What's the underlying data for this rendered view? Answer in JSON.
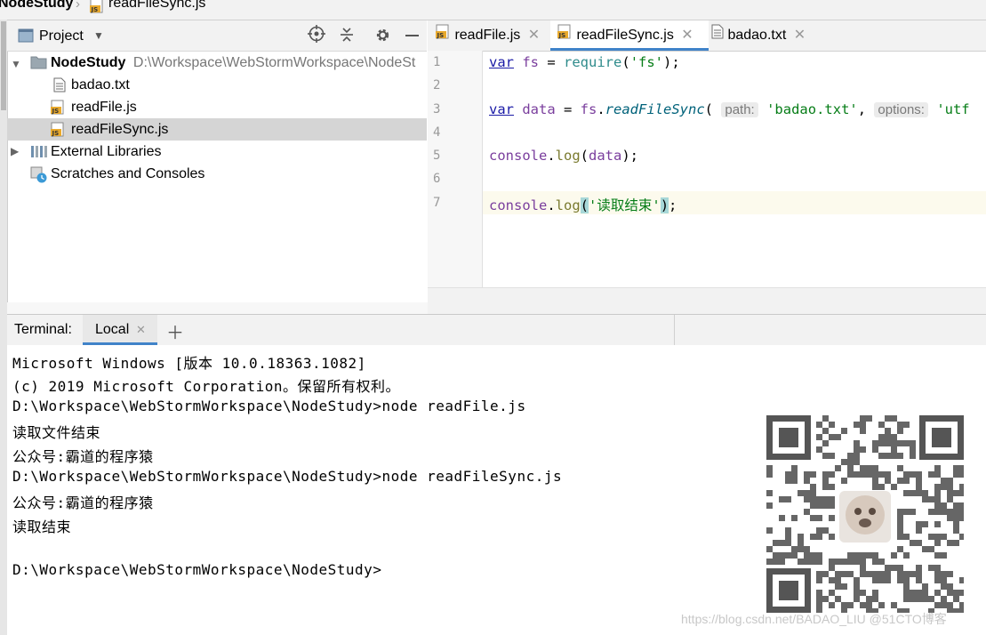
{
  "breadcrumb": {
    "project": "NodeStudy",
    "file": "readFileSync.js"
  },
  "project_panel": {
    "title": "Project",
    "tree": {
      "root_name": "NodeStudy",
      "root_path": "D:\\Workspace\\WebStormWorkspace\\NodeSt",
      "files": [
        "badao.txt",
        "readFile.js",
        "readFileSync.js"
      ],
      "external": "External Libraries",
      "scratches": "Scratches and Consoles"
    }
  },
  "editor": {
    "tabs": [
      "readFile.js",
      "readFileSync.js",
      "badao.txt"
    ],
    "active_tab": "readFileSync.js",
    "line_numbers": [
      "1",
      "2",
      "3",
      "4",
      "5",
      "6",
      "7"
    ],
    "code": {
      "l1": {
        "kw": "var",
        "name": "fs",
        "op": " = ",
        "fn": "require",
        "open": "(",
        "str": "'fs'",
        "close": ");"
      },
      "l3": {
        "kw": "var",
        "name": "data",
        "op": " = ",
        "obj": "fs",
        "dot": ".",
        "fn": "readFileSync",
        "open": "(",
        "hint1": "path:",
        "str1": "'badao.txt'",
        "comma": ",",
        "hint2": "options:",
        "str2": "'utf"
      },
      "l5": {
        "obj": "console",
        "dot": ".",
        "fn": "log",
        "open": "(",
        "arg": "data",
        "close": ");"
      },
      "l7": {
        "obj": "console",
        "dot": ".",
        "fn": "log",
        "open": "(",
        "str": "'读取结束'",
        "close1": ")",
        "close2": ";"
      }
    }
  },
  "terminal": {
    "label": "Terminal:",
    "tab": "Local",
    "lines": [
      "Microsoft Windows [版本 10.0.18363.1082]",
      "(c) 2019 Microsoft Corporation。保留所有权利。",
      "D:\\Workspace\\WebStormWorkspace\\NodeStudy>node readFile.js",
      "读取文件结束",
      "公众号:霸道的程序猿",
      "D:\\Workspace\\WebStormWorkspace\\NodeStudy>node readFileSync.js",
      "公众号:霸道的程序猿",
      "读取结束",
      "",
      "D:\\Workspace\\WebStormWorkspace\\NodeStudy>"
    ]
  },
  "watermark": "https://blog.csdn.net/BADAO_LIU @51CTO博客",
  "colors": {
    "accent": "#4083c9",
    "selection": "#d5d5d5",
    "keyword": "#1a1aa6",
    "string": "#067d17"
  }
}
